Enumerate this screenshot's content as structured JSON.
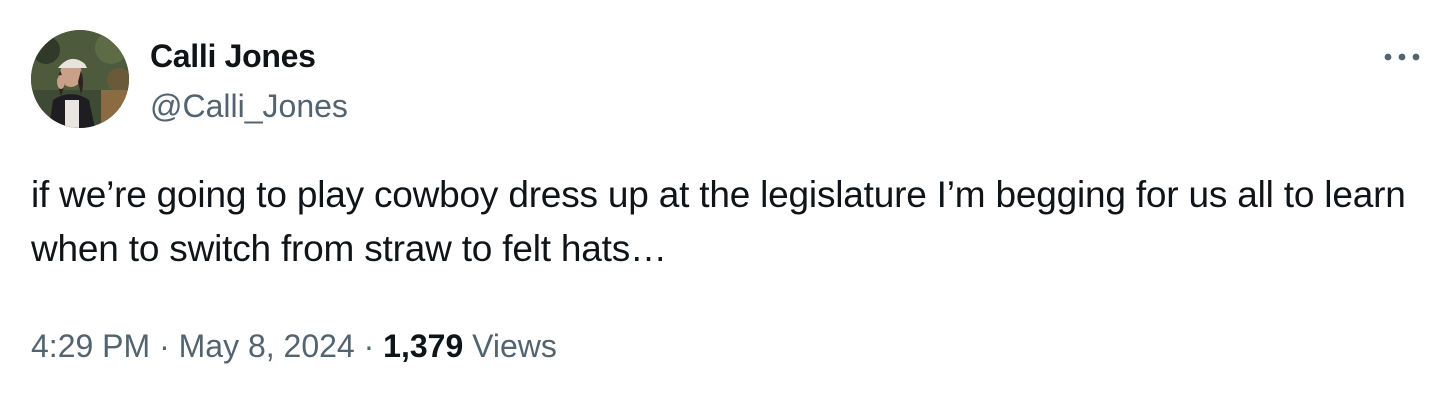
{
  "author": {
    "display_name": "Calli Jones",
    "handle": "@Calli_Jones",
    "avatar_icon": "profile-photo"
  },
  "more_icon": "more-dots-icon",
  "tweet": {
    "text": "if we’re going to play cowboy dress up at the legislature I’m begging for us all to learn when to switch from straw to felt hats…"
  },
  "meta": {
    "time": "4:29 PM",
    "separator": " · ",
    "date": "May 8, 2024",
    "views_count": "1,379",
    "views_label": " Views"
  },
  "colors": {
    "text_primary": "#0f1419",
    "text_secondary": "#536471",
    "background": "#ffffff"
  }
}
